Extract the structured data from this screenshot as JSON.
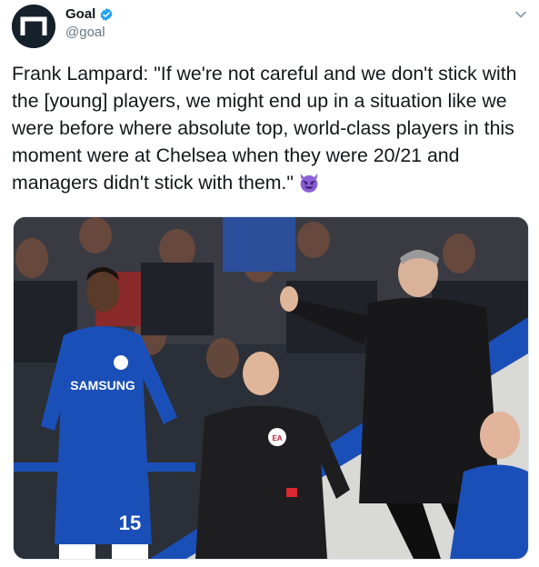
{
  "tweet": {
    "author_name": "Goal",
    "author_handle": "@goal",
    "verified": true,
    "text": "Frank Lampard: \"If we're not careful and we don't stick with the [young] players, we might end up in a situation like we were before where absolute top, world-class players in this moment were at Chelsea when they were 20/21 and managers didn't stick with them.\"",
    "emoji": "smiling-face-with-horns-icon",
    "media": {
      "shirt_sponsor": "SAMSUNG",
      "shirt_number": "15",
      "badge_text": "EA"
    }
  },
  "colors": {
    "name": "#14171a",
    "handle": "#657786",
    "verified": "#1da1f2",
    "chelsea_blue": "#1b4fb8",
    "emoji_purple": "#8b5fd6"
  }
}
